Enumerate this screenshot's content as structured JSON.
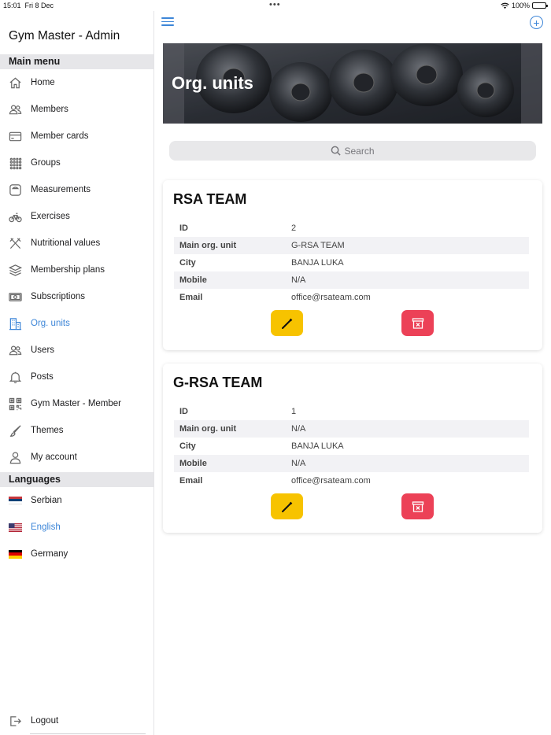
{
  "status_bar": {
    "time": "15:01",
    "date": "Fri 8 Dec",
    "battery": "100%"
  },
  "sidebar": {
    "app_title": "Gym Master - Admin",
    "main_menu_header": "Main menu",
    "items": [
      {
        "label": "Home",
        "icon": "home-icon"
      },
      {
        "label": "Members",
        "icon": "people-icon"
      },
      {
        "label": "Member cards",
        "icon": "card-icon"
      },
      {
        "label": "Groups",
        "icon": "grid-icon"
      },
      {
        "label": "Measurements",
        "icon": "scale-icon"
      },
      {
        "label": "Exercises",
        "icon": "bicycle-icon"
      },
      {
        "label": "Nutritional values",
        "icon": "utensils-icon"
      },
      {
        "label": "Membership plans",
        "icon": "layers-icon"
      },
      {
        "label": "Subscriptions",
        "icon": "money-icon"
      },
      {
        "label": "Org. units",
        "icon": "building-icon",
        "active": true
      },
      {
        "label": "Users",
        "icon": "people-icon"
      },
      {
        "label": "Posts",
        "icon": "bell-icon"
      },
      {
        "label": "Gym Master - Member",
        "icon": "qr-code-icon"
      },
      {
        "label": "Themes",
        "icon": "brush-icon"
      },
      {
        "label": "My account",
        "icon": "person-icon"
      }
    ],
    "languages_header": "Languages",
    "languages": [
      {
        "label": "Serbian",
        "icon": "flag-serbia-icon"
      },
      {
        "label": "English",
        "icon": "flag-us-icon",
        "active": true
      },
      {
        "label": "Germany",
        "icon": "flag-germany-icon"
      }
    ],
    "logout_label": "Logout"
  },
  "main": {
    "banner_title": "Org. units",
    "search_placeholder": "Search",
    "field_labels": {
      "id": "ID",
      "main_org_unit": "Main org. unit",
      "city": "City",
      "mobile": "Mobile",
      "email": "Email"
    },
    "org_units": [
      {
        "name": "RSA TEAM",
        "id": "2",
        "main_org_unit": "G-RSA TEAM",
        "city": "BANJA LUKA",
        "mobile": "N/A",
        "email": "office@rsateam.com"
      },
      {
        "name": "G-RSA TEAM",
        "id": "1",
        "main_org_unit": "N/A",
        "city": "BANJA LUKA",
        "mobile": "N/A",
        "email": "office@rsateam.com"
      }
    ]
  },
  "colors": {
    "accent": "#3d86d8",
    "edit_button": "#f7c300",
    "delete_button": "#ec4157",
    "section_header_bg": "#e6e6e9"
  }
}
